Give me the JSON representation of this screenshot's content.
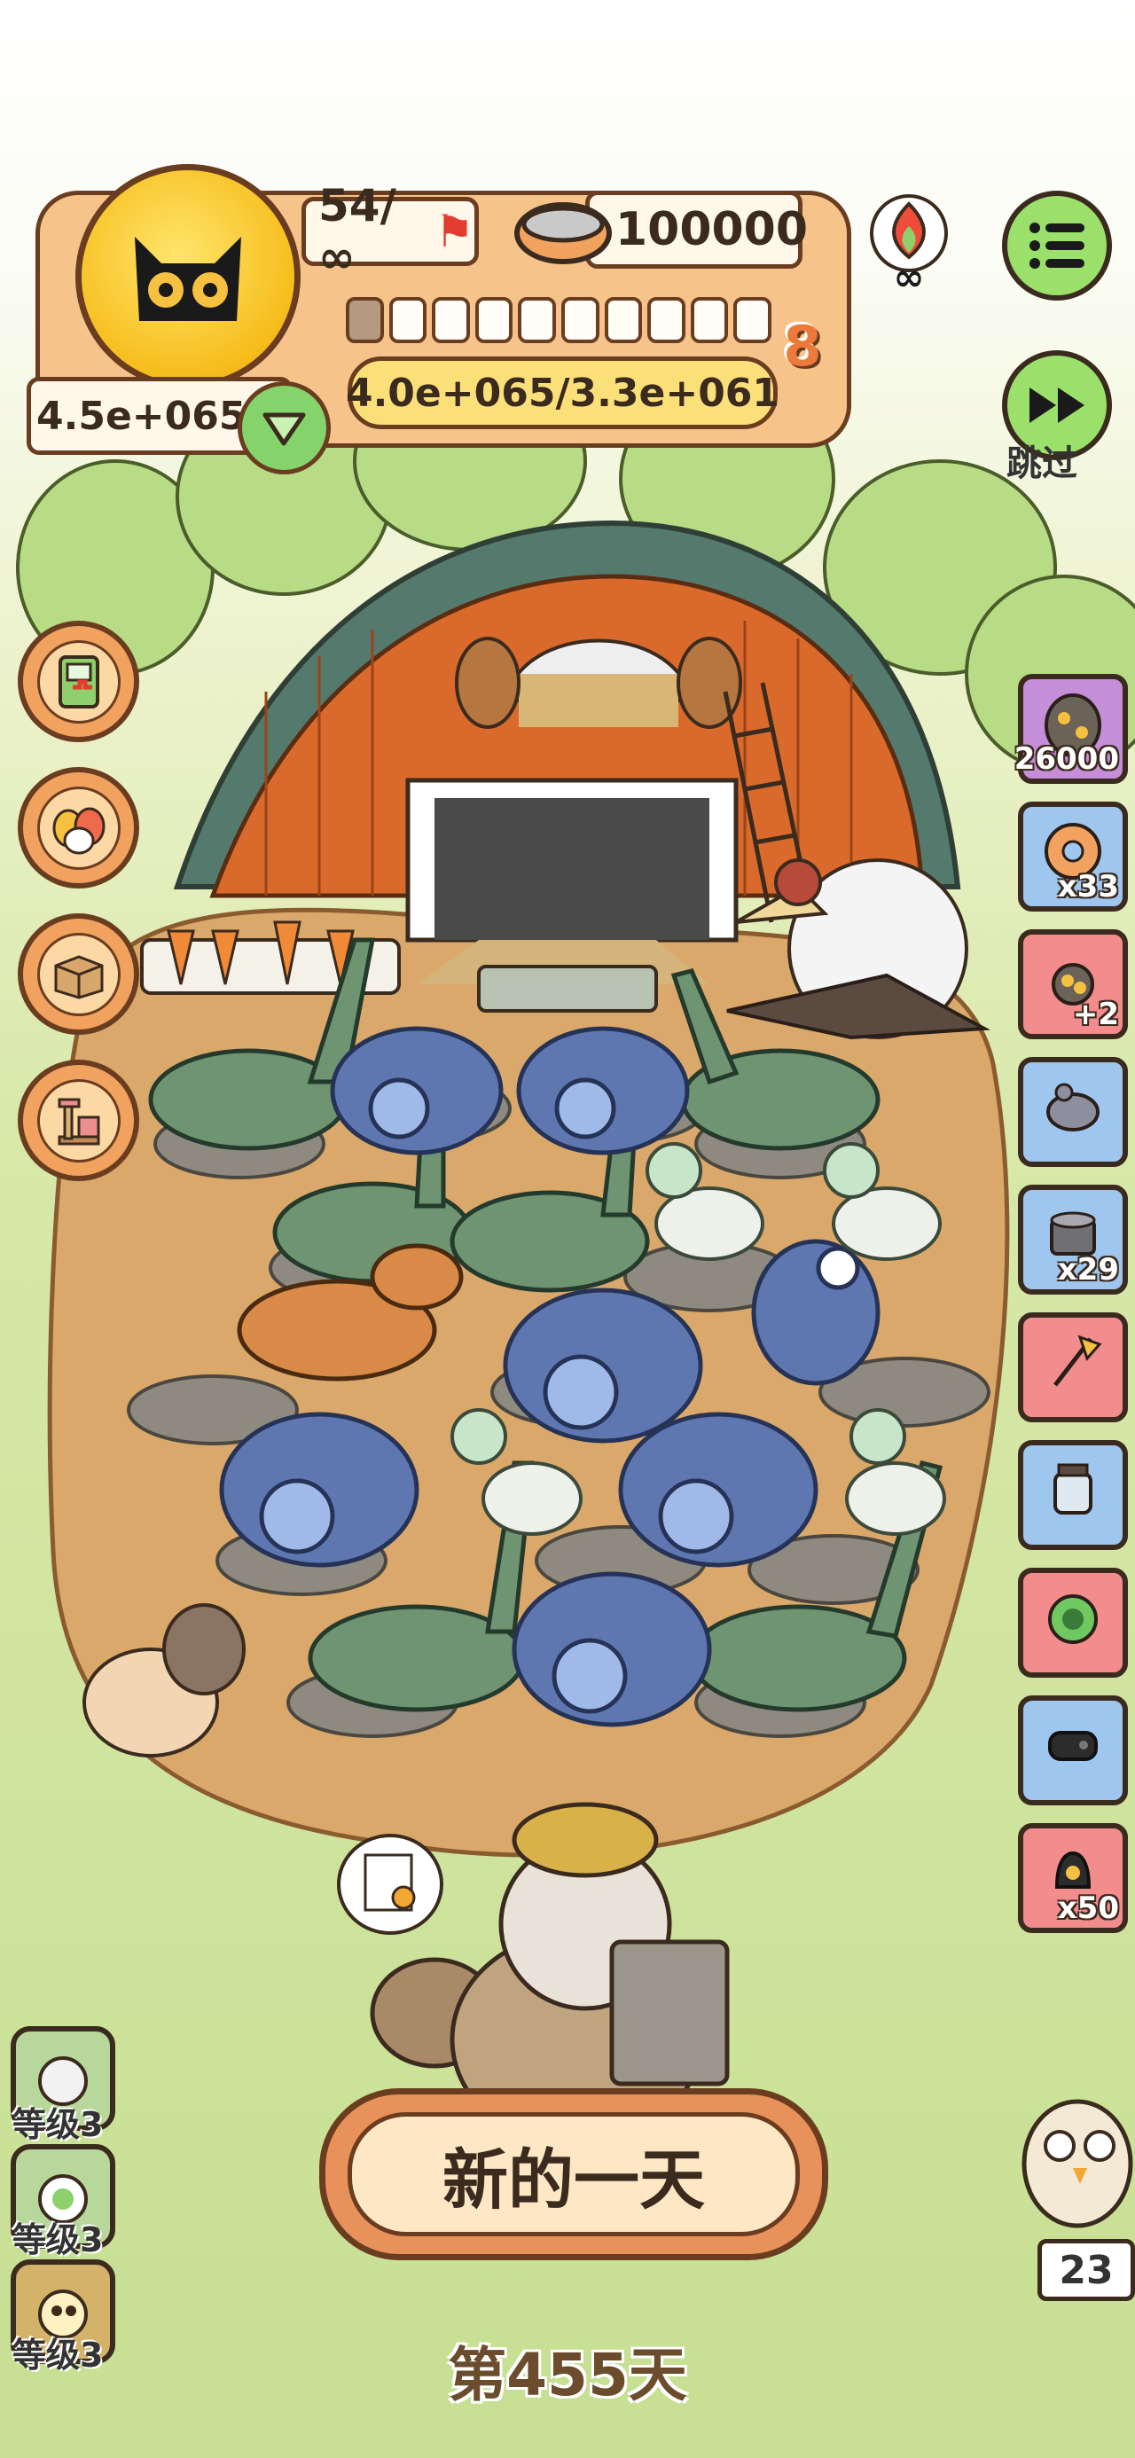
{
  "hud": {
    "stamina": "54/∞",
    "coins": "100000",
    "progress_filled": 1,
    "progress_total": 10,
    "level": "8",
    "exp": "4.0e+065/3.3e+061",
    "money": "4.5e+065"
  },
  "skip_label": "跳过",
  "items": [
    {
      "name": "rock-egg",
      "color": "purple",
      "count": "26000"
    },
    {
      "name": "donut",
      "color": "blue",
      "count": "x33"
    },
    {
      "name": "paw-plus",
      "color": "red",
      "count": "+2"
    },
    {
      "name": "toy-mouse",
      "color": "blue",
      "count": ""
    },
    {
      "name": "can",
      "color": "blue",
      "count": "x29"
    },
    {
      "name": "feather-toy",
      "color": "red",
      "count": ""
    },
    {
      "name": "jar",
      "color": "blue",
      "count": ""
    },
    {
      "name": "cabbage",
      "color": "red",
      "count": ""
    },
    {
      "name": "gamepad",
      "color": "blue",
      "count": ""
    },
    {
      "name": "bell",
      "color": "red",
      "count": "x50"
    }
  ],
  "left_buttons": [
    "handheld-console",
    "eggs-basket",
    "cardboard-box",
    "cat-tree"
  ],
  "main_button": "新的一天",
  "day_label": "第455天",
  "levels": [
    {
      "label": "等级3",
      "icon": "white-creature"
    },
    {
      "label": "等级3",
      "icon": "green-creature"
    },
    {
      "label": "等级3",
      "icon": "yellow-creature"
    }
  ],
  "owl_count": "23",
  "colors": {
    "accent": "#f6c48b",
    "outline": "#6a3d20",
    "green_button": "#9be06b"
  }
}
